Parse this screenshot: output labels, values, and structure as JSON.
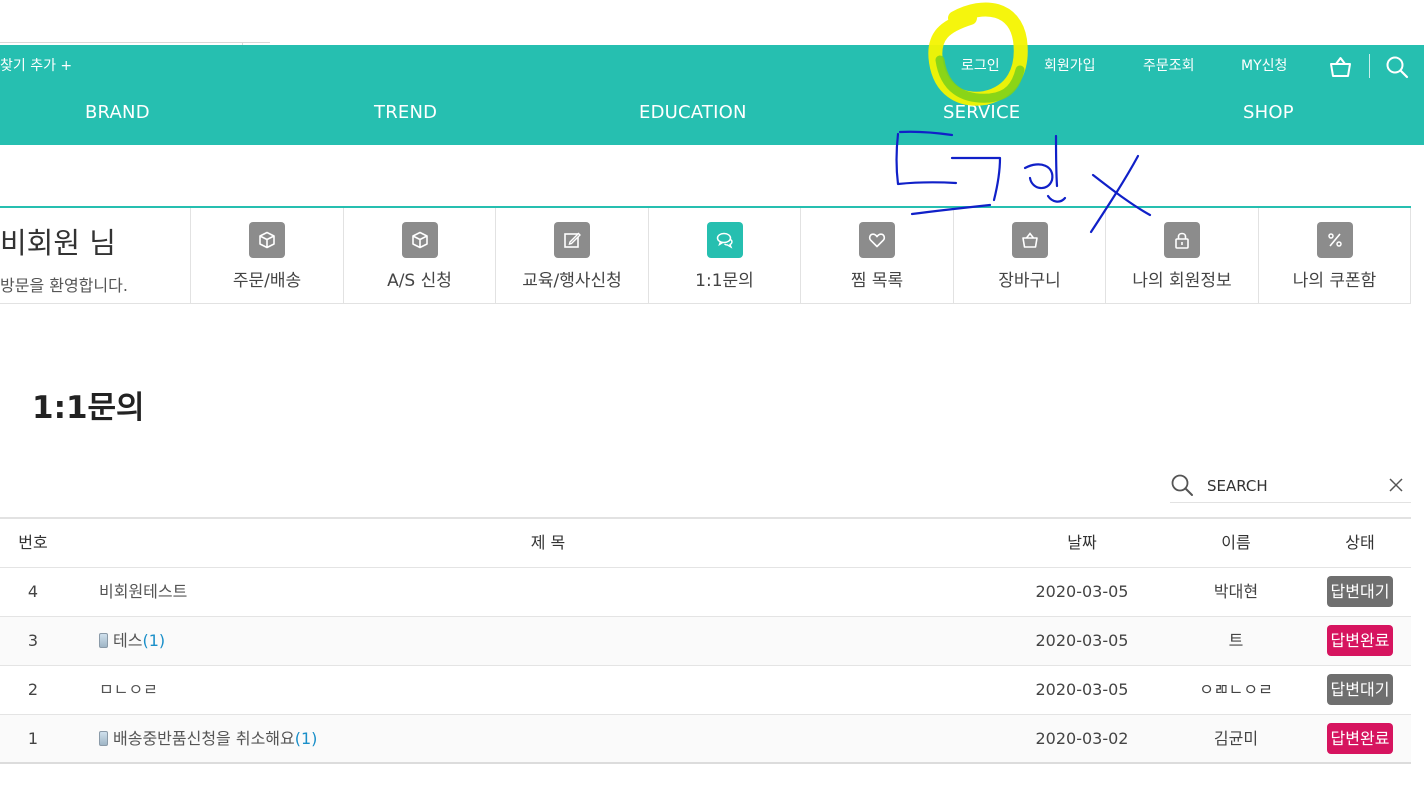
{
  "header": {
    "bookmark_label": "찾기 추가 +",
    "util_links": {
      "login": "로그인",
      "join": "회원가입",
      "order": "주문조회",
      "my_request": "MY신청"
    },
    "icons": {
      "cart": "cart-icon",
      "search": "search-icon"
    },
    "gnb": {
      "brand": "BRAND",
      "trend": "TREND",
      "education": "EDUCATION",
      "service": "SERVICE",
      "shop": "SHOP"
    },
    "bg_color": "#26bfb0"
  },
  "member": {
    "name": "비회원 님",
    "welcome": "방문을 환영합니다."
  },
  "mypage_menu": [
    {
      "label": "주문/배송",
      "icon": "box-icon"
    },
    {
      "label": "A/S 신청",
      "icon": "box-icon"
    },
    {
      "label": "교육/행사신청",
      "icon": "edit-icon"
    },
    {
      "label": "1:1문의",
      "icon": "chat-icon",
      "active": true
    },
    {
      "label": "찜 목록",
      "icon": "heart-icon"
    },
    {
      "label": "장바구니",
      "icon": "basket-icon"
    },
    {
      "label": "나의 회원정보",
      "icon": "lock-icon"
    },
    {
      "label": "나의 쿠폰함",
      "icon": "percent-icon"
    }
  ],
  "page_title": "1:1문의",
  "search": {
    "label": "SEARCH"
  },
  "board": {
    "headers": {
      "no": "번호",
      "subject": "제 목",
      "date": "날짜",
      "name": "이름",
      "state": "상태"
    },
    "rows": [
      {
        "no": "4",
        "subject": "비회원테스트",
        "reply": "",
        "mobile": false,
        "date": "2020-03-05",
        "name": "박대현",
        "state": "답변대기",
        "state_type": "wait"
      },
      {
        "no": "3",
        "subject": "테스",
        "reply": "(1)",
        "mobile": true,
        "date": "2020-03-05",
        "name": "트",
        "state": "답변완료",
        "state_type": "done"
      },
      {
        "no": "2",
        "subject": "ㅁㄴㅇㄹ",
        "reply": "",
        "mobile": false,
        "date": "2020-03-05",
        "name": "ㅇㄻㄴㅇㄹ",
        "state": "답변대기",
        "state_type": "wait"
      },
      {
        "no": "1",
        "subject": "배송중반품신청을 취소해요",
        "reply": "(1)",
        "mobile": true,
        "date": "2020-03-02",
        "name": "김균미",
        "state": "답변완료",
        "state_type": "done"
      }
    ]
  },
  "annotation": {
    "note": "로그인 X",
    "highlight_color": "#f4f400",
    "pen_color": "#1020c8"
  }
}
